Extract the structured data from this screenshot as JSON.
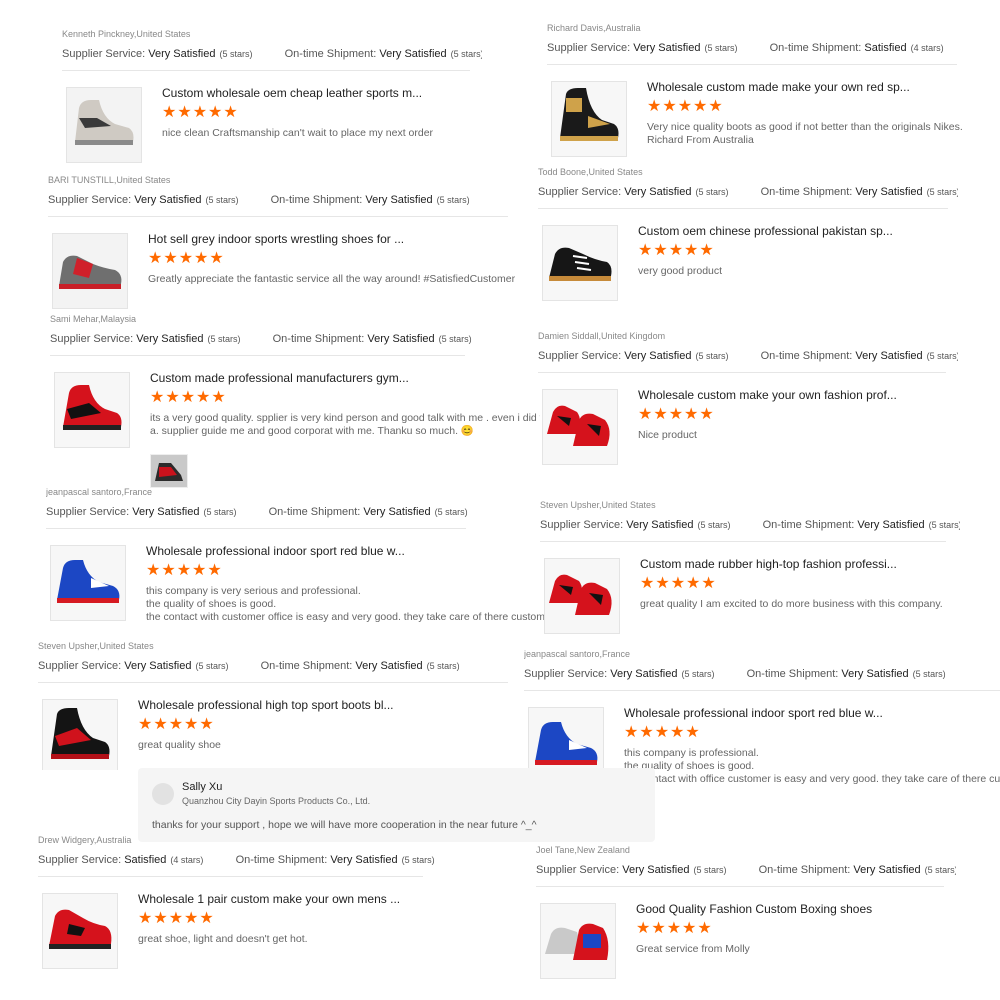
{
  "labels": {
    "supplier_service": "Supplier Service: ",
    "on_time_shipment": "On-time Shipment: "
  },
  "colors": {
    "star": "#ff6a00",
    "divider": "#e6e6e6",
    "reply_bg": "#f5f5f5"
  },
  "reviews": [
    {
      "reviewer": "Kenneth Pinckney,United States",
      "supplier_rating": "Very Satisfied",
      "supplier_stars": "(5 stars)",
      "shipment_rating": "Very Satisfied",
      "shipment_stars": "(5 stars)",
      "product_title": "Custom wholesale oem cheap leather sports m...",
      "stars": "★★★★★",
      "comment": [
        "nice clean Craftsmanship can't wait to place my next order"
      ],
      "product_image": "grey-white-boxing-shoe"
    },
    {
      "reviewer": "BARI TUNSTILL,United States",
      "supplier_rating": "Very Satisfied",
      "supplier_stars": "(5 stars)",
      "shipment_rating": "Very Satisfied",
      "shipment_stars": "(5 stars)",
      "product_title": "Hot sell grey indoor sports wrestling shoes for ...",
      "stars": "★★★★★",
      "comment": [
        "Greatly appreciate the fantastic service all the way around! #SatisfiedCustomer"
      ],
      "product_image": "grey-red-wrestling-shoe"
    },
    {
      "reviewer": "Sami Mehar,Malaysia",
      "supplier_rating": "Very Satisfied",
      "supplier_stars": "(5 stars)",
      "shipment_rating": "Very Satisfied",
      "shipment_stars": "(5 stars)",
      "product_title": "Custom made professional manufacturers gym...",
      "stars": "★★★★★",
      "comment": [
        "its a very good quality.  spplier is very kind person and good talk with me . even i did first order with",
        "a.  supplier guide me and good corporat with me. Thanku so much.  😊"
      ],
      "product_image": "red-black-boxing-shoe"
    },
    {
      "reviewer": "jeanpascal santoro,France",
      "supplier_rating": "Very Satisfied",
      "supplier_stars": "(5 stars)",
      "shipment_rating": "Very Satisfied",
      "shipment_stars": "(5 stars)",
      "product_title": "Wholesale professional indoor sport red blue w...",
      "stars": "★★★★★",
      "comment": [
        "this company is very serious and professional.",
        "the quality of shoes is good.",
        "the contact with  customer office is easy and very good. they take care of there customers"
      ],
      "product_image": "blue-wrestling-shoe"
    },
    {
      "reviewer": "Steven Upsher,United States",
      "supplier_rating": "Very Satisfied",
      "supplier_stars": "(5 stars)",
      "shipment_rating": "Very Satisfied",
      "shipment_stars": "(5 stars)",
      "product_title": "Wholesale professional high top sport boots bl...",
      "stars": "★★★★★",
      "comment": [
        "great quality shoe"
      ],
      "product_image": "black-red-high-top-boot"
    },
    {
      "reviewer": "Drew Widgery,Australia",
      "supplier_rating": "Satisfied",
      "supplier_stars": "(4 stars)",
      "shipment_rating": "Very Satisfied",
      "shipment_stars": "(5 stars)",
      "product_title": "Wholesale 1 pair custom make your own mens ...",
      "stars": "★★★★★",
      "comment": [
        "great shoe, light and doesn't get hot."
      ],
      "product_image": "red-wrestling-shoe"
    },
    {
      "reviewer": "Richard Davis,Australia",
      "supplier_rating": "Very Satisfied",
      "supplier_stars": "(5 stars)",
      "shipment_rating": "Satisfied",
      "shipment_stars": "(4 stars)",
      "product_title": "Wholesale custom made make your own red sp...",
      "stars": "★★★★★",
      "comment": [
        "Very nice quality boots as good if not better than the originals Nikes.",
        "Richard From Australia"
      ],
      "product_image": "black-gold-boxing-boot"
    },
    {
      "reviewer": "Todd Boone,United States",
      "supplier_rating": "Very Satisfied",
      "supplier_stars": "(5 stars)",
      "shipment_rating": "Very Satisfied",
      "shipment_stars": "(5 stars)",
      "product_title": "Custom oem chinese professional pakistan sp...",
      "stars": "★★★★★",
      "comment": [
        "very good product"
      ],
      "product_image": "black-white-low-shoe"
    },
    {
      "reviewer": "Damien Siddall,United Kingdom",
      "supplier_rating": "Very Satisfied",
      "supplier_stars": "(5 stars)",
      "shipment_rating": "Very Satisfied",
      "shipment_stars": "(5 stars)",
      "product_title": "Wholesale custom make your own fashion prof...",
      "stars": "★★★★★",
      "comment": [
        "Nice product"
      ],
      "product_image": "red-wrestling-shoes-pair"
    },
    {
      "reviewer": "Steven Upsher,United States",
      "supplier_rating": "Very Satisfied",
      "supplier_stars": "(5 stars)",
      "shipment_rating": "Very Satisfied",
      "shipment_stars": "(5 stars)",
      "product_title": "Custom made rubber high-top fashion professi...",
      "stars": "★★★★★",
      "comment": [
        "great quality I am excited to do more business with this company."
      ],
      "product_image": "red-wrestling-shoes-pair"
    },
    {
      "reviewer": "jeanpascal santoro,France",
      "supplier_rating": "Very Satisfied",
      "supplier_stars": "(5 stars)",
      "shipment_rating": "Very Satisfied",
      "shipment_stars": "(5 stars)",
      "product_title": "Wholesale professional indoor sport red blue w...",
      "stars": "★★★★★",
      "comment": [
        "this company is professional.",
        "the quality of shoes is good.",
        "the contact with office customer is easy and very good. they take care of there customers"
      ],
      "product_image": "blue-wrestling-shoe"
    },
    {
      "reviewer": "Joel Tane,New Zealand",
      "supplier_rating": "Very Satisfied",
      "supplier_stars": "(5 stars)",
      "shipment_rating": "Very Satisfied",
      "shipment_stars": "(5 stars)",
      "product_title": "Good Quality Fashion Custom Boxing shoes",
      "stars": "★★★★★",
      "comment": [
        "Great service from Molly"
      ],
      "product_image": "red-blue-boxing-shoe"
    }
  ],
  "reply": {
    "name": "Sally Xu",
    "company": "Quanzhou City Dayin Sports Products Co., Ltd.",
    "message": "thanks for your support , hope we will have more cooperation in the near future ^_^"
  }
}
